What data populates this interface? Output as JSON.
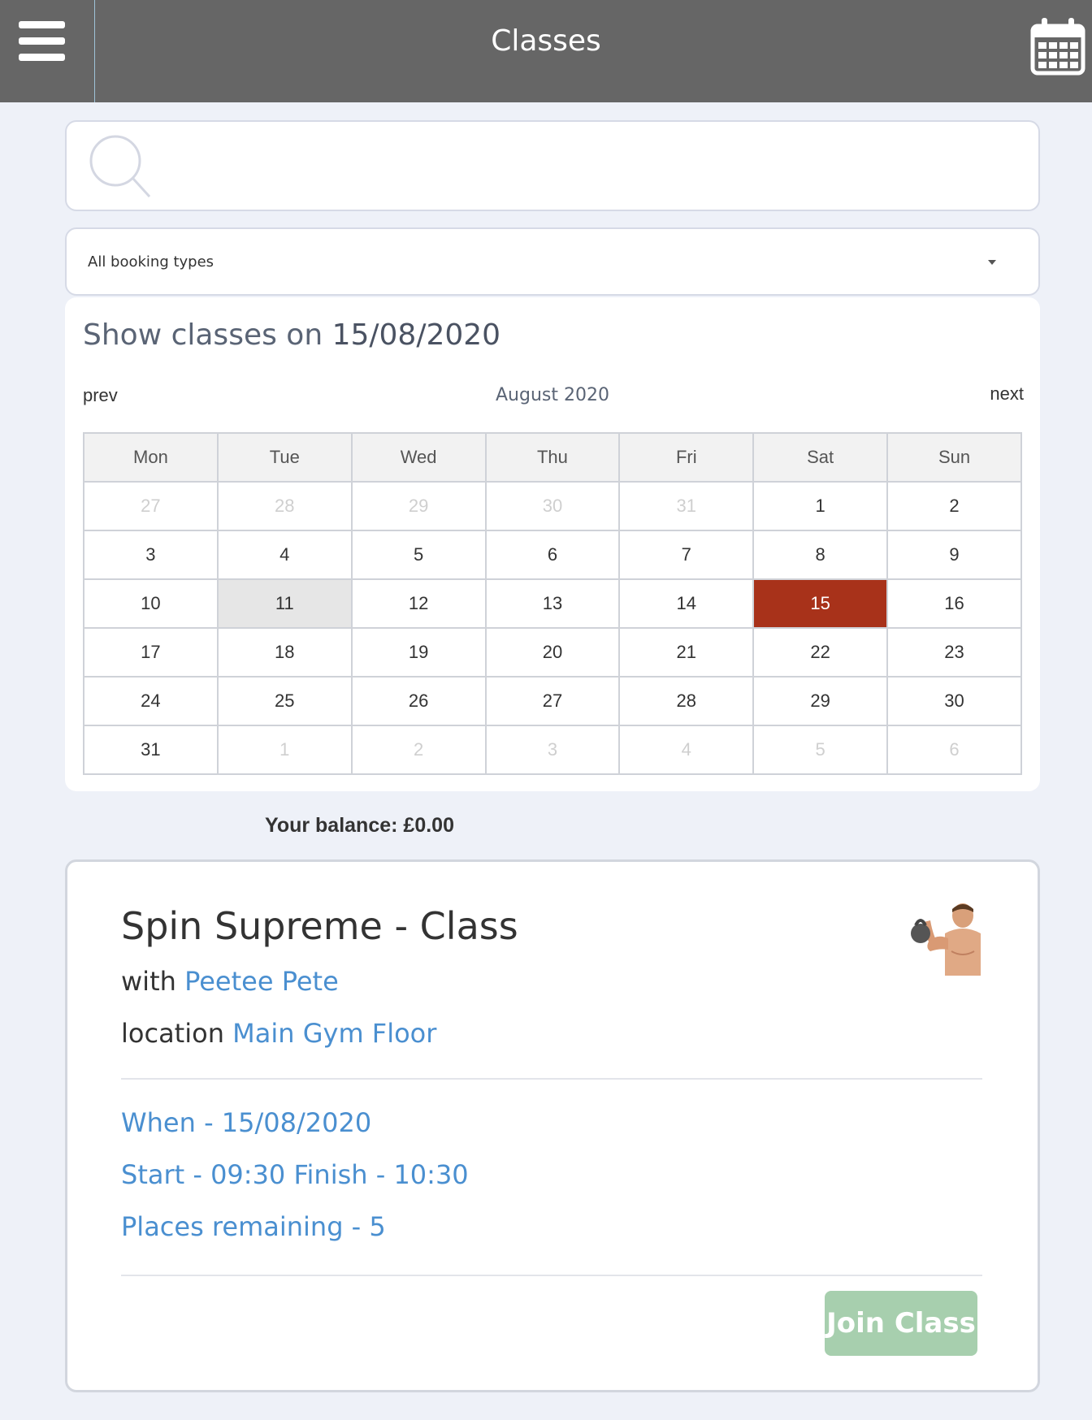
{
  "header": {
    "title": "Classes",
    "menu_icon": "hamburger-icon",
    "calendar_icon": "calendar-icon"
  },
  "search": {
    "value": "",
    "placeholder": "",
    "icon": "search-icon"
  },
  "filter": {
    "selected": "All booking types"
  },
  "calendar": {
    "label": "Show classes on",
    "selected_date": "15/08/2020",
    "prev_label": "prev",
    "next_label": "next",
    "month_title": "August 2020",
    "weekdays": [
      "Mon",
      "Tue",
      "Wed",
      "Thu",
      "Fri",
      "Sat",
      "Sun"
    ],
    "weeks": [
      [
        "27",
        "28",
        "29",
        "30",
        "31",
        "1",
        "2"
      ],
      [
        "3",
        "4",
        "5",
        "6",
        "7",
        "8",
        "9"
      ],
      [
        "10",
        "11",
        "12",
        "13",
        "14",
        "15",
        "16"
      ],
      [
        "17",
        "18",
        "19",
        "20",
        "21",
        "22",
        "23"
      ],
      [
        "24",
        "25",
        "26",
        "27",
        "28",
        "29",
        "30"
      ],
      [
        "31",
        "1",
        "2",
        "3",
        "4",
        "5",
        "6"
      ]
    ],
    "selected_color": "#a8321a"
  },
  "balance": {
    "text": "Your balance: £0.00"
  },
  "class_card": {
    "title": "Spin Supreme - Class",
    "with_label": "with",
    "instructor": "Peetee Pete",
    "location_label": "location",
    "location": "Main Gym Floor",
    "when": "When - 15/08/2020",
    "times": "Start - 09:30 Finish - 10:30",
    "places": "Places remaining - 5",
    "join_label": "Join Class",
    "thumbnail": "kettlebell-man-icon",
    "link_color": "#4a8fd0",
    "join_color": "#a7cfae"
  }
}
